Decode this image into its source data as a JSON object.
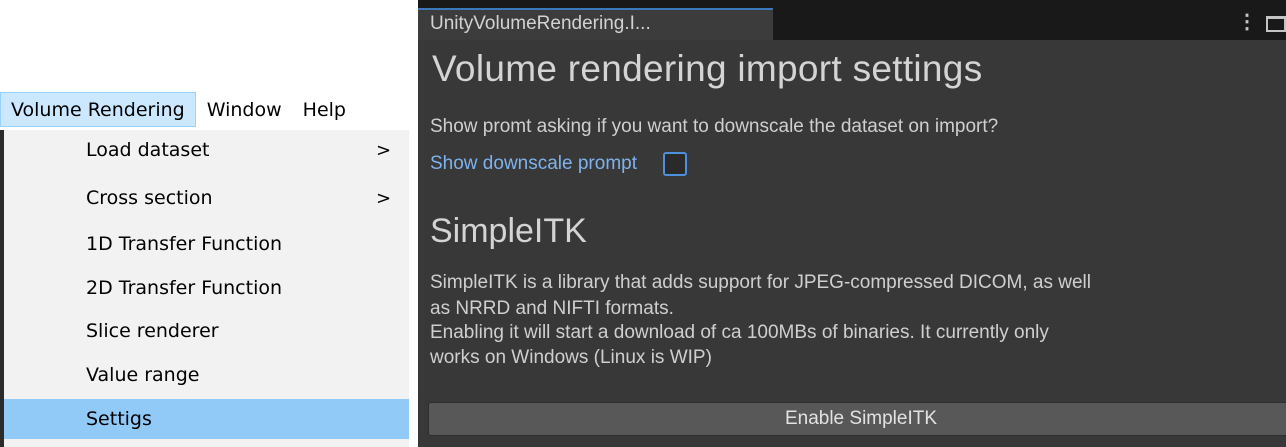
{
  "menubar": {
    "items": [
      "Volume Rendering",
      "Window",
      "Help"
    ]
  },
  "dropdown": {
    "items": [
      {
        "label": "Load dataset",
        "submenu": true
      },
      {
        "label": "Cross section",
        "submenu": true
      },
      {
        "label": "1D Transfer Function",
        "submenu": false
      },
      {
        "label": "2D Transfer Function",
        "submenu": false
      },
      {
        "label": "Slice renderer",
        "submenu": false
      },
      {
        "label": "Value range",
        "submenu": false
      },
      {
        "label": "Settigs",
        "submenu": false,
        "highlighted": true
      }
    ],
    "arrow_glyph": ">"
  },
  "window": {
    "tab_title": "UnityVolumeRendering.I...",
    "kebab_glyph": "⋮"
  },
  "import_settings": {
    "heading": "Volume rendering import settings",
    "description": "Show promt asking if you want to downscale the dataset on import?",
    "toggle_label": "Show downscale prompt",
    "toggle_checked": false
  },
  "simpleitk": {
    "heading": "SimpleITK",
    "lines": [
      "SimpleITK is a library that adds support for JPEG-compressed DICOM, as well",
      "as NRRD and NIFTI formats.",
      "Enabling it will start a download of ca 100MBs of binaries. It currently only",
      "works on Windows (Linux is WIP)"
    ],
    "button_label": "Enable SimpleITK"
  },
  "colors": {
    "unity_background": "#383838",
    "menu_highlight": "#91c9f7",
    "link_blue": "#7fb2ec",
    "tab_accent": "#3a79bb"
  }
}
